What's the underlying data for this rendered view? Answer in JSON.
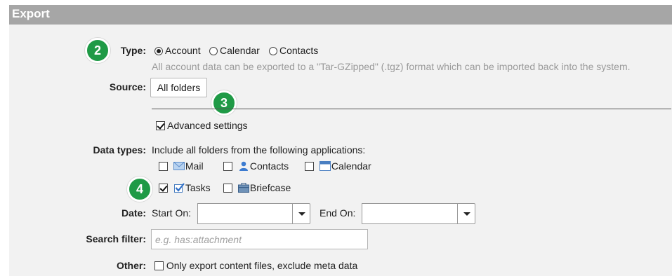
{
  "header": {
    "title": "Export"
  },
  "badges": {
    "b2": "2",
    "b3": "3",
    "b4": "4"
  },
  "type": {
    "label": "Type:",
    "options": [
      {
        "label": "Account",
        "selected": true
      },
      {
        "label": "Calendar",
        "selected": false
      },
      {
        "label": "Contacts",
        "selected": false
      }
    ],
    "note": "All account data can be exported to a \"Tar-GZipped\" (.tgz) format which can be imported back into the system."
  },
  "source": {
    "label": "Source:",
    "button": "All folders"
  },
  "advanced": {
    "label": "Advanced settings",
    "checked": true
  },
  "data_types": {
    "label": "Data types:",
    "intro": "Include all folders from the following applications:",
    "apps": [
      {
        "label": "Mail",
        "checked": false,
        "icon": "mail-icon"
      },
      {
        "label": "Contacts",
        "checked": false,
        "icon": "contacts-icon"
      },
      {
        "label": "Calendar",
        "checked": false,
        "icon": "calendar-icon"
      },
      {
        "label": "Tasks",
        "checked": true,
        "icon": "tasks-icon"
      },
      {
        "label": "Briefcase",
        "checked": false,
        "icon": "briefcase-icon"
      }
    ]
  },
  "date": {
    "label": "Date:",
    "start_label": "Start On:",
    "end_label": "End On:",
    "start_value": "",
    "end_value": ""
  },
  "search_filter": {
    "label": "Search filter:",
    "placeholder": "e.g. has:attachment"
  },
  "other": {
    "label": "Other:",
    "option": "Only export content files, exclude meta data",
    "checked": false
  },
  "colors": {
    "header_bg": "#a6a6a6",
    "panel_bg": "#f2f2f2",
    "badge": "#1f9a46"
  }
}
